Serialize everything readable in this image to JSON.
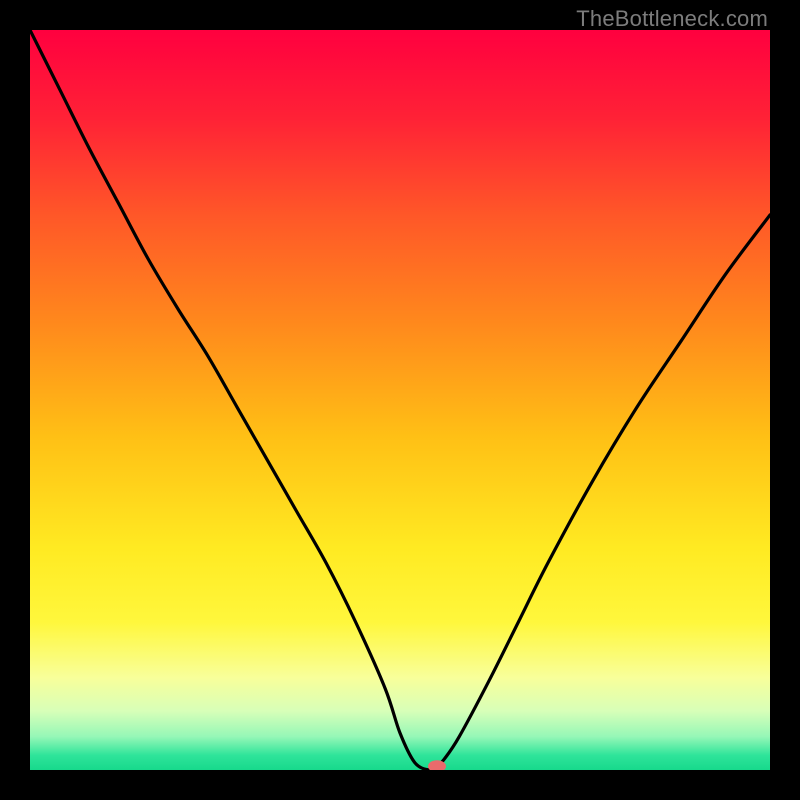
{
  "watermark": "TheBottleneck.com",
  "colors": {
    "curve": "#000000",
    "marker_fill": "#ea6a6c",
    "marker_stroke": "#c94a4c",
    "gradient_stops": [
      {
        "offset": 0.0,
        "color": "#ff003f"
      },
      {
        "offset": 0.12,
        "color": "#ff2236"
      },
      {
        "offset": 0.25,
        "color": "#ff5728"
      },
      {
        "offset": 0.4,
        "color": "#ff8a1c"
      },
      {
        "offset": 0.55,
        "color": "#ffc015"
      },
      {
        "offset": 0.7,
        "color": "#ffea22"
      },
      {
        "offset": 0.8,
        "color": "#fff73c"
      },
      {
        "offset": 0.875,
        "color": "#f8ff9a"
      },
      {
        "offset": 0.92,
        "color": "#d8ffb8"
      },
      {
        "offset": 0.955,
        "color": "#95f7b7"
      },
      {
        "offset": 0.98,
        "color": "#2fe49a"
      },
      {
        "offset": 1.0,
        "color": "#17d98c"
      }
    ]
  },
  "chart_data": {
    "type": "line",
    "title": "",
    "xlabel": "",
    "ylabel": "",
    "xlim": [
      0,
      100
    ],
    "ylim": [
      0,
      100
    ],
    "x": [
      0,
      4,
      8,
      12,
      16,
      20,
      24,
      28,
      32,
      36,
      40,
      44,
      48,
      50,
      52,
      54,
      55,
      56,
      58,
      62,
      66,
      70,
      76,
      82,
      88,
      94,
      100
    ],
    "values": [
      100,
      92,
      84,
      76.5,
      69,
      62.3,
      56,
      49,
      42,
      35,
      28,
      20,
      11,
      5,
      1,
      0,
      0.5,
      1.5,
      4.5,
      12,
      20,
      28,
      39,
      49,
      58,
      67,
      75
    ],
    "marker": {
      "x": 55,
      "y": 0.5
    }
  }
}
